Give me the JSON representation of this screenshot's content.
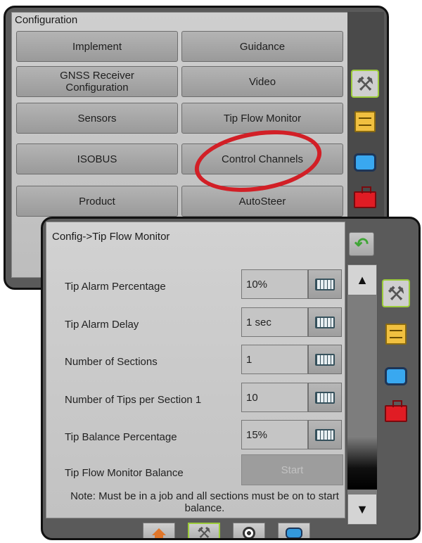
{
  "back_panel": {
    "title": "Configuration",
    "buttons": [
      {
        "label": "Implement"
      },
      {
        "label": "Guidance"
      },
      {
        "label": "GNSS Receiver Configuration"
      },
      {
        "label": "Video"
      },
      {
        "label": "Sensors"
      },
      {
        "label": "Tip Flow Monitor"
      },
      {
        "label": "ISOBUS"
      },
      {
        "label": "Control Channels"
      },
      {
        "label": "Product"
      },
      {
        "label": "AutoSteer"
      }
    ],
    "highlighted": "Control Channels"
  },
  "side_tabs": [
    {
      "icon": "tools-icon",
      "selected": true
    },
    {
      "icon": "file-cabinet-icon",
      "selected": false
    },
    {
      "icon": "monitor-icon",
      "selected": false
    },
    {
      "icon": "toolbox-icon",
      "selected": false
    }
  ],
  "front_panel": {
    "title": "Config->Tip Flow Monitor",
    "rows": [
      {
        "label": "Tip Alarm Percentage",
        "value": "10%"
      },
      {
        "label": "Tip Alarm Delay",
        "value": "1 sec"
      },
      {
        "label": "Number of Sections",
        "value": "1"
      },
      {
        "label": "Number of Tips per Section 1",
        "value": "10"
      },
      {
        "label": "Tip Balance Percentage",
        "value": "15%"
      }
    ],
    "balance": {
      "label": "Tip Flow Monitor Balance",
      "button": "Start"
    },
    "note": "Note: Must be in a job and all sections must be on to start balance."
  },
  "bottom_nav": [
    {
      "icon": "home-icon",
      "selected": false
    },
    {
      "icon": "tools-icon",
      "selected": true
    },
    {
      "icon": "gps-icon",
      "selected": false
    },
    {
      "icon": "toggle-icon",
      "selected": false
    }
  ],
  "colors": {
    "highlight": "#d21f26",
    "selected_border": "#9ccc3a",
    "back_arrow": "#3fa535"
  }
}
